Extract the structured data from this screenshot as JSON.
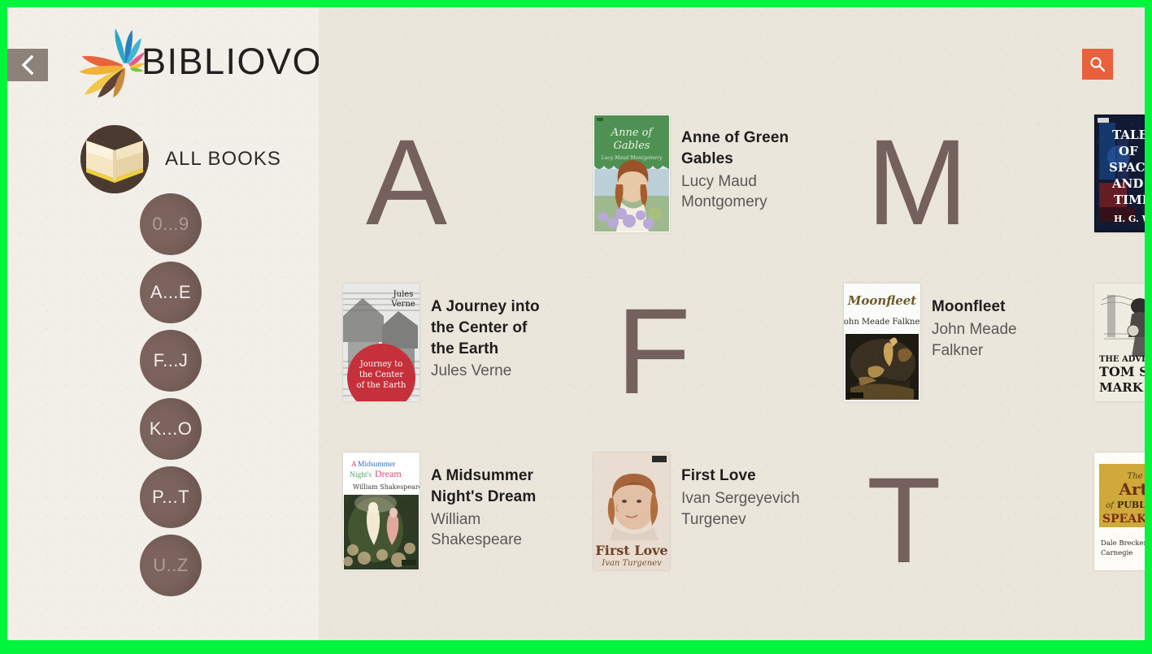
{
  "app": {
    "name": "BIBLIOVORE",
    "frame_color": "#00f53c",
    "accent_color": "#e8603c",
    "letter_color": "#74605c",
    "pill_color": "#7c635d",
    "background_color": "#eae6dc"
  },
  "nav": {
    "back_label": "",
    "back_icon": "chevron-left-icon",
    "all_books_label": "ALL BOOKS",
    "all_books_icon": "open-book-icon",
    "search_icon": "search-icon",
    "letter_groups": [
      {
        "label": "0...9",
        "enabled": false
      },
      {
        "label": "A...E",
        "enabled": true
      },
      {
        "label": "F...J",
        "enabled": true
      },
      {
        "label": "K...O",
        "enabled": true
      },
      {
        "label": "P...T",
        "enabled": true
      },
      {
        "label": "U..Z",
        "enabled": false
      }
    ]
  },
  "grid": {
    "cells": [
      {
        "kind": "letter",
        "letter": "A"
      },
      {
        "kind": "book",
        "title": "Anne of Green Gables",
        "author": "Lucy Maud Montgomery",
        "cover": "anne-of-green-gables"
      },
      {
        "kind": "letter",
        "letter": "M"
      },
      {
        "kind": "book",
        "title": "Tales of Space and Time",
        "author": "H. G. Wells",
        "cover": "tales-of-space-and-time",
        "clipped": true
      },
      {
        "kind": "book",
        "title": "A Journey into the Center of the Earth",
        "author": "Jules Verne",
        "cover": "journey-center-earth"
      },
      {
        "kind": "letter",
        "letter": "F"
      },
      {
        "kind": "book",
        "title": "Moonfleet",
        "author": "John Meade Falkner",
        "cover": "moonfleet"
      },
      {
        "kind": "book",
        "title": "The Adventures of Tom Sawyer",
        "author": "Mark Twain",
        "cover": "tom-sawyer",
        "clipped": true
      },
      {
        "kind": "book",
        "title": "A Midsummer Night's Dream",
        "author": "William Shakespeare",
        "cover": "midsummer-nights-dream"
      },
      {
        "kind": "book",
        "title": "First Love",
        "author": "Ivan Sergeyevich Turgenev",
        "cover": "first-love"
      },
      {
        "kind": "letter",
        "letter": "T"
      },
      {
        "kind": "book",
        "title": "The Art of Public Speaking",
        "author": "Dale Breckenridge Carnegie",
        "cover": "art-of-public-speaking",
        "clipped": true
      }
    ]
  }
}
